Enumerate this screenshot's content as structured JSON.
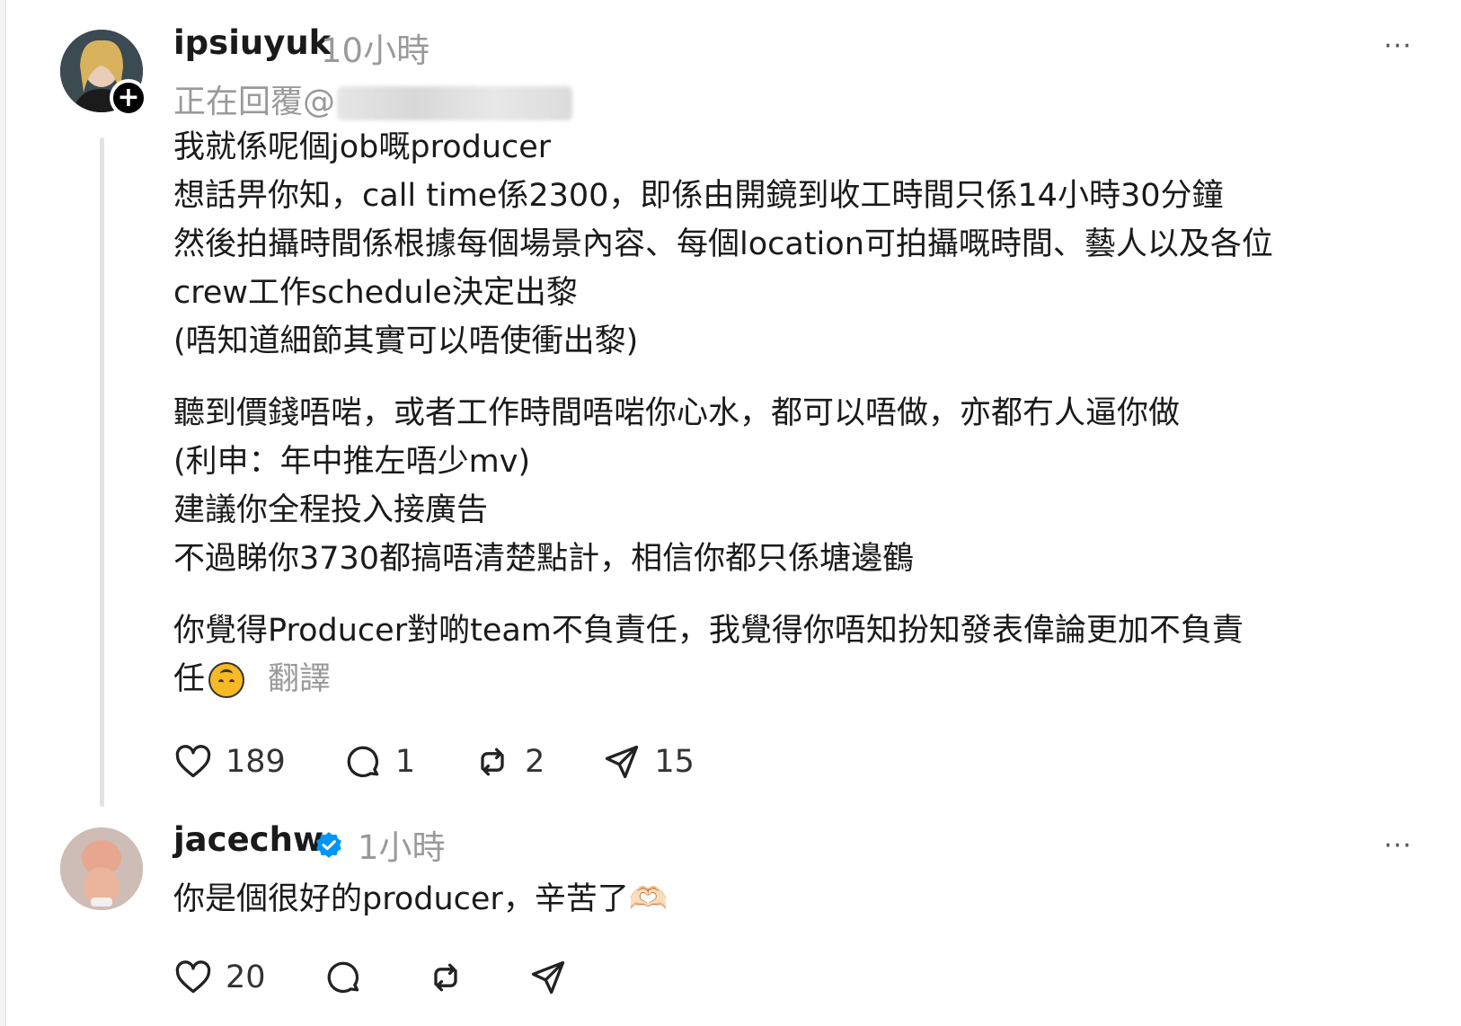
{
  "post1": {
    "username": "ipsiuyuk",
    "time": "10小時",
    "more": "···",
    "follow_badge": "+",
    "reply_prefix": "正在回覆@",
    "lines": [
      "我就係呢個job嘅producer",
      "想話畀你知，call time係2300，即係由開鏡到收工時間只係14小時30分鐘",
      "然後拍攝時間係根據每個場景內容、每個location可拍攝嘅時間、藝人以及各位",
      "crew工作schedule決定出黎",
      "(唔知道細節其實可以唔使衝出黎)￼",
      "",
      "聽到價錢唔啱，或者工作時間唔啱你心水，都可以唔做，亦都冇人逼你做￼",
      "(利申：年中推左唔少mv)",
      "建議你全程投入接廣告",
      "不過睇你3730￼都搞唔清楚點計，相信你都只係塘邊鶴￼",
      "",
      "你覺得Producer對啲￼team不負責任，我覺得你唔知扮知發表偉￼論更加不負責"
    ],
    "last_line": "任￼",
    "translate": "翻譯",
    "likes": "189",
    "comments": "1",
    "reposts": "2",
    "shares": "15"
  },
  "post2": {
    "username": "jacechw",
    "time": "1小時",
    "more": "···",
    "text": "你是個很好的producer，辛苦了🫶🏻",
    "likes": "20"
  },
  "icons": {
    "like": "heart-icon",
    "comment": "comment-bubble-icon",
    "repost": "repost-icon",
    "share": "send-icon",
    "verified": "verified-badge-icon",
    "emoji": "upside-down-face-emoji"
  },
  "colors": {
    "text": "#1a1a1a",
    "muted": "#9a9a9a",
    "verified": "#0095f6"
  }
}
